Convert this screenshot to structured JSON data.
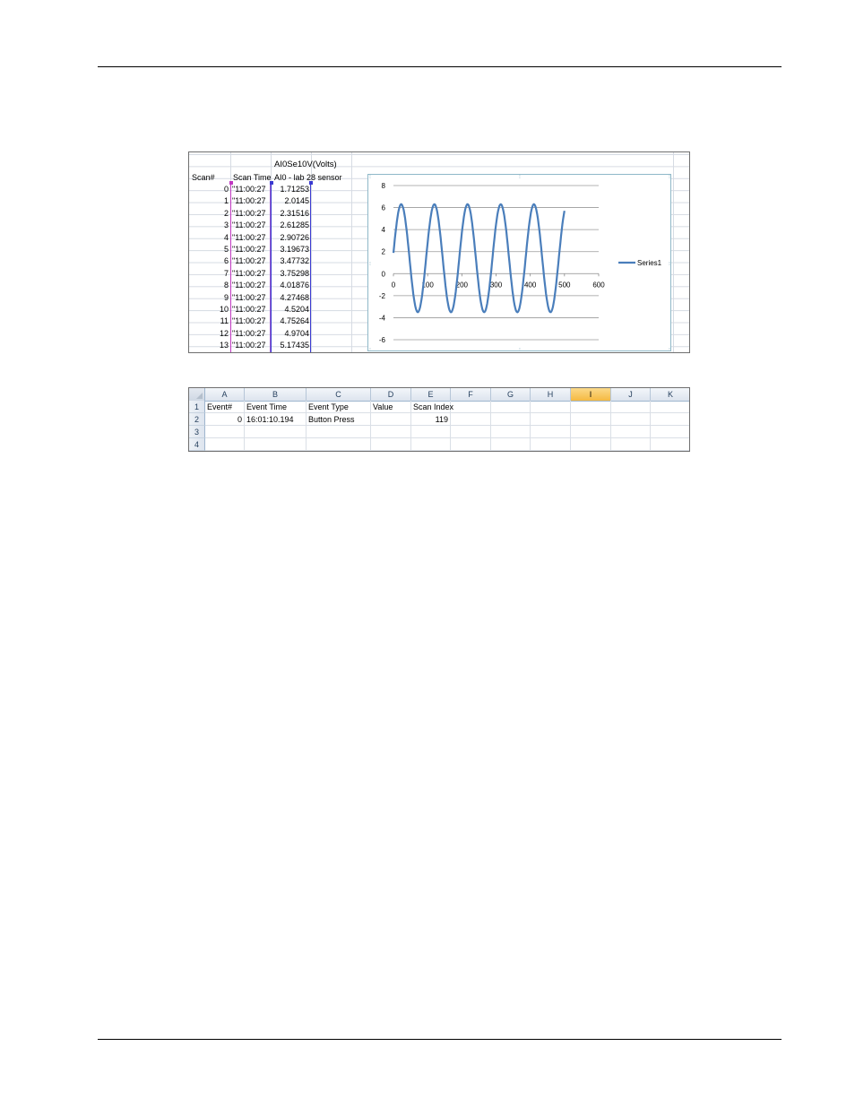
{
  "sheet1": {
    "channel_title": "AI0Se10V(Volts)",
    "headers": {
      "scan": "Scan#",
      "time": "Scan Time",
      "value": "AI0 - lab 28 sensor"
    },
    "rows": [
      {
        "scan": "0",
        "time": "\"11:00:27",
        "value": "1.71253"
      },
      {
        "scan": "1",
        "time": "\"11:00:27",
        "value": "2.0145"
      },
      {
        "scan": "2",
        "time": "\"11:00:27",
        "value": "2.31516"
      },
      {
        "scan": "3",
        "time": "\"11:00:27",
        "value": "2.61285"
      },
      {
        "scan": "4",
        "time": "\"11:00:27",
        "value": "2.90726"
      },
      {
        "scan": "5",
        "time": "\"11:00:27",
        "value": "3.19673"
      },
      {
        "scan": "6",
        "time": "\"11:00:27",
        "value": "3.47732"
      },
      {
        "scan": "7",
        "time": "\"11:00:27",
        "value": "3.75298"
      },
      {
        "scan": "8",
        "time": "\"11:00:27",
        "value": "4.01876"
      },
      {
        "scan": "9",
        "time": "\"11:00:27",
        "value": "4.27468"
      },
      {
        "scan": "10",
        "time": "\"11:00:27",
        "value": "4.5204"
      },
      {
        "scan": "11",
        "time": "\"11:00:27",
        "value": "4.75264"
      },
      {
        "scan": "12",
        "time": "\"11:00:27",
        "value": "4.9704"
      },
      {
        "scan": "13",
        "time": "\"11:00:27",
        "value": "5.17435"
      }
    ]
  },
  "chart_data": {
    "type": "line",
    "title": "",
    "xlabel": "",
    "ylabel": "",
    "xlim": [
      0,
      600
    ],
    "ylim": [
      -6,
      8
    ],
    "x_ticks": [
      "0",
      "100",
      "200",
      "300",
      "400",
      "500",
      "600"
    ],
    "y_ticks": [
      "8",
      "6",
      "4",
      "2",
      "0",
      "-2",
      "-4",
      "-6"
    ],
    "grid": true,
    "legend": "right",
    "series": [
      {
        "name": "Series1",
        "color": "#4a7ebb",
        "function": "sine",
        "offset": 1.4,
        "amplitude": 4.9,
        "period": 97,
        "x_range": [
          0,
          500
        ]
      }
    ]
  },
  "sheet2": {
    "columns": [
      "A",
      "B",
      "C",
      "D",
      "E",
      "F",
      "G",
      "H",
      "I",
      "J",
      "K"
    ],
    "active_column": "I",
    "row_numbers": [
      "1",
      "2",
      "3",
      "4"
    ],
    "header_row": {
      "A": "Event#",
      "B": "Event Time",
      "C": "Event Type",
      "D": "Value",
      "E": "Scan Index"
    },
    "data_row": {
      "A": "0",
      "B": "16:01:10.194",
      "C": "Button Press",
      "E": "119"
    }
  },
  "colors": {
    "active_header": "#f5b941",
    "series": "#4a7ebb"
  }
}
